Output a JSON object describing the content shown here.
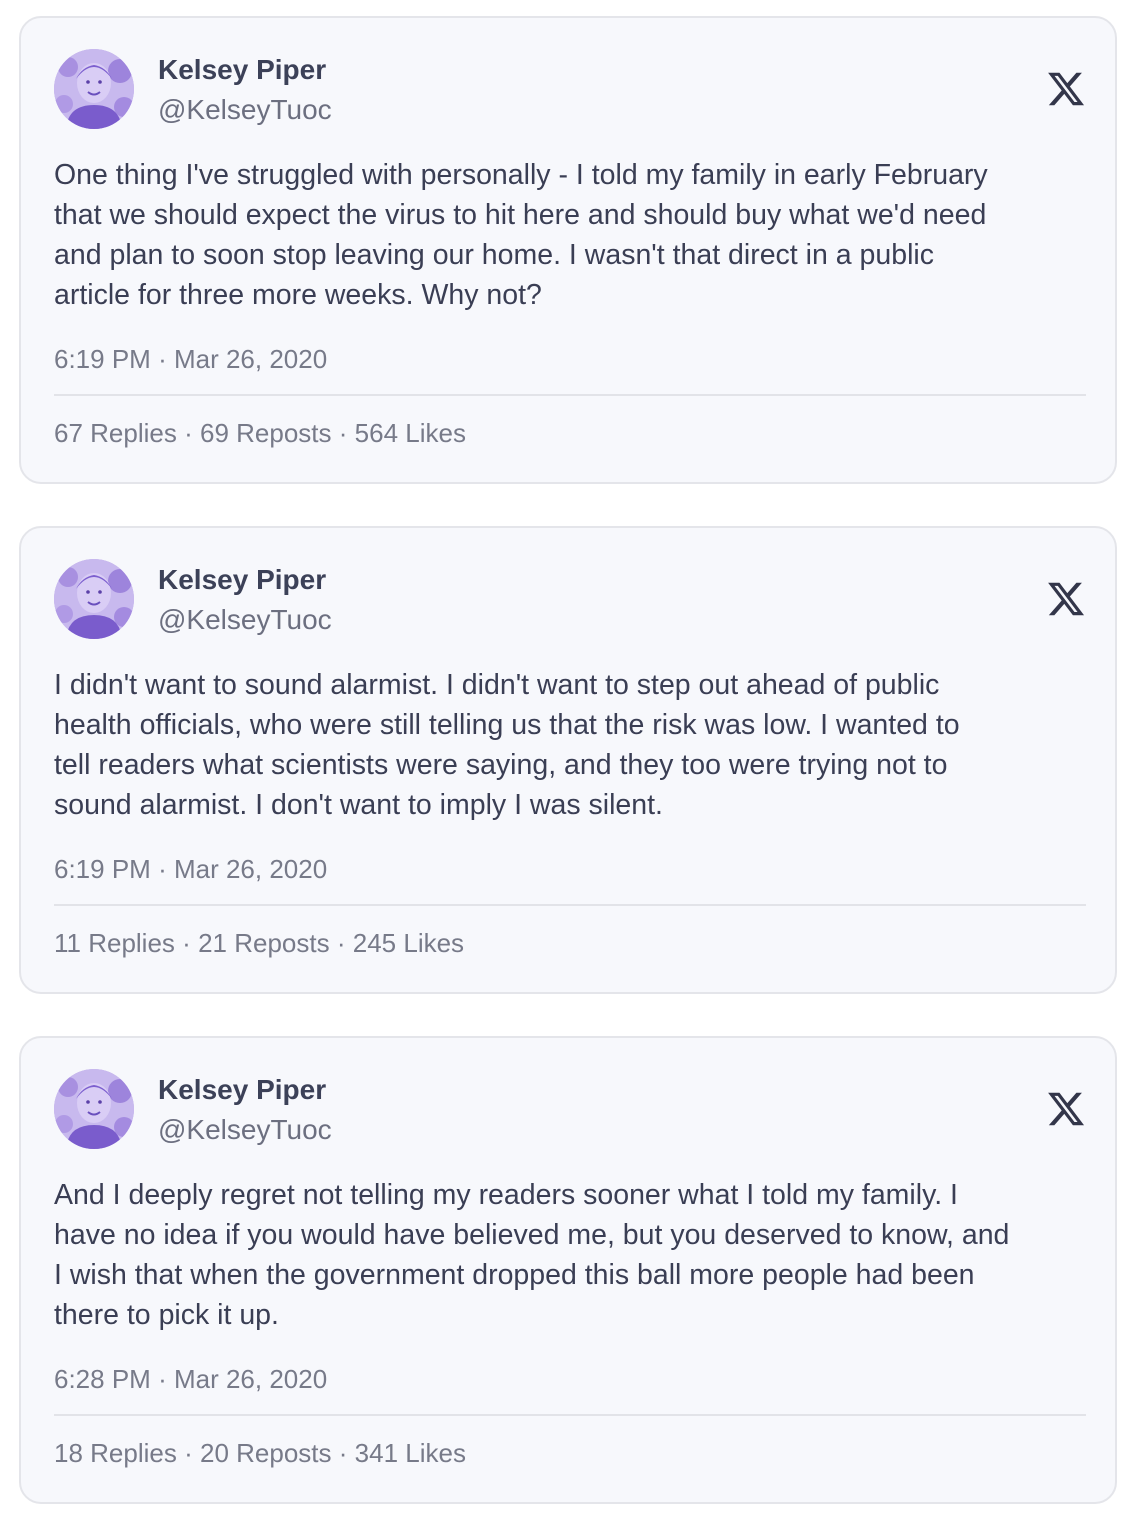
{
  "tweets": [
    {
      "author_name": "Kelsey Piper",
      "author_handle": "@KelseyTuoc",
      "text_lines": [
        "One thing I've struggled with personally - I told my family in early February",
        "that we should expect the virus to hit here and should buy what we'd need",
        "and plan to soon stop leaving our home. I wasn't that direct in a public",
        "article for three more weeks. Why not?"
      ],
      "time": "6:19 PM",
      "date": "Mar 26, 2020",
      "replies": "67 Replies",
      "reposts": "69 Reposts",
      "likes": "564 Likes"
    },
    {
      "author_name": "Kelsey Piper",
      "author_handle": "@KelseyTuoc",
      "text_lines": [
        "I didn't want to sound alarmist. I didn't want to step out ahead of public",
        "health officials, who were still telling us that the risk was low. I wanted to",
        "tell readers what scientists were saying, and they too were trying not to",
        "sound alarmist. I don't want to imply I was silent."
      ],
      "time": "6:19 PM",
      "date": "Mar 26, 2020",
      "replies": "11 Replies",
      "reposts": "21 Reposts",
      "likes": "245 Likes"
    },
    {
      "author_name": "Kelsey Piper",
      "author_handle": "@KelseyTuoc",
      "text_lines": [
        "And I deeply regret not telling my readers sooner what I told my family. I",
        "have no idea if you would have believed me, but you deserved to know, and",
        "I wish that when the government dropped this ball more people had been",
        "there to pick it up."
      ],
      "time": "6:28 PM",
      "date": "Mar 26, 2020",
      "replies": "18 Replies",
      "reposts": "20 Reposts",
      "likes": "341 Likes"
    }
  ],
  "separator": "·",
  "icons": {
    "platform_logo": "x-logo-icon",
    "avatar": "avatar"
  },
  "colors": {
    "card_background": "#f7f8fc",
    "card_border": "#e4e5ea",
    "name_text": "#3c4158",
    "body_text": "#3a3e54",
    "muted_text": "#777a89",
    "avatar_tint": "#8e72d6"
  }
}
